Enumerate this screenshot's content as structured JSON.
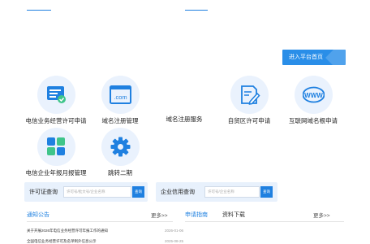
{
  "header": {
    "enter_platform": "进入平台首页"
  },
  "services": [
    {
      "label": "电信业务经营许可申请",
      "icon": "license-card-icon"
    },
    {
      "label": "域名注册管理",
      "icon": "dotcom-browser-icon"
    },
    {
      "label": "域名注册服务",
      "icon": ""
    },
    {
      "label": "自贸区许可申请",
      "icon": "document-pen-icon"
    },
    {
      "label": "互联网域名根申请",
      "icon": "www-globe-icon"
    },
    {
      "label": "电信企业年报月报管理",
      "icon": "grid-tiles-icon"
    },
    {
      "label": "跳转二期",
      "icon": "gear-icon"
    }
  ],
  "license_search": {
    "title": "许可证查询",
    "placeholder": "许可号/批文号/企业名称",
    "button": "查询"
  },
  "credit_search": {
    "title": "企业信用查询",
    "placeholder": "许可号/企业名称",
    "button": "查询"
  },
  "notices": {
    "tab": "通知公告",
    "more": "更多>>",
    "items": [
      {
        "title": "关于开展2026年电信业务经营许可年报工作的通知",
        "date": "2026-01-06"
      },
      {
        "title": "全国电信业务经营许可及名单制外信息公示",
        "date": "2025-08-25"
      }
    ]
  },
  "guide": {
    "tab_active": "申请指南",
    "tab_other": "资料下载",
    "more": "更多>>"
  },
  "colors": {
    "accent": "#1f80e0",
    "icon_bg": "#eaf2fd",
    "panel_bg": "#e8f1fc"
  }
}
